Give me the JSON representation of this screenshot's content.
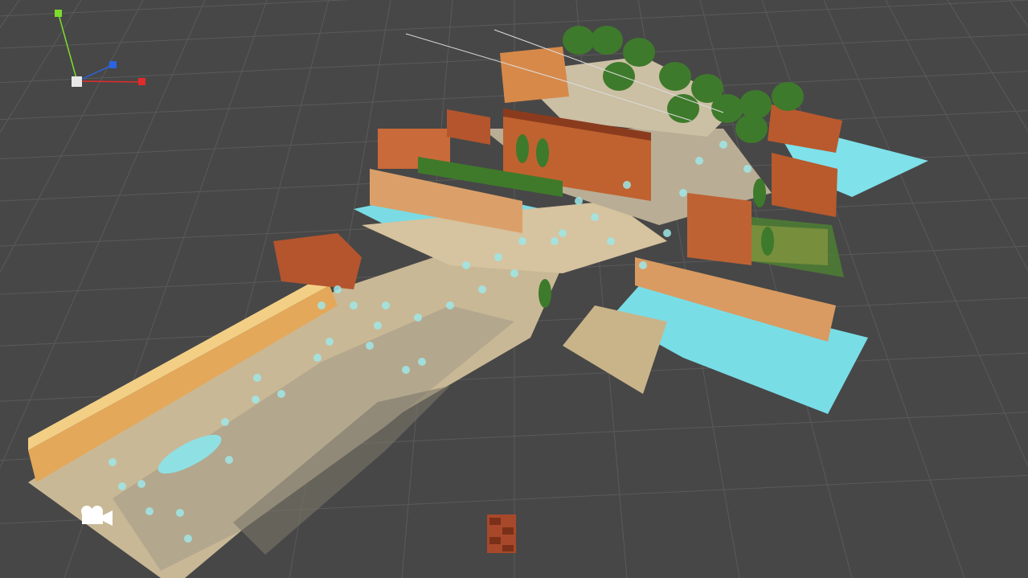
{
  "scene": {
    "view": "scene-view-3d",
    "grid": true,
    "background_color": "#474747",
    "grid_color": "#5a5a5a"
  },
  "gizmo": {
    "axes": [
      {
        "axis": "y",
        "color": "#7ddc2b"
      },
      {
        "axis": "z",
        "color": "#2b63e0"
      },
      {
        "axis": "x",
        "color": "#e02b2b"
      }
    ],
    "center_color": "#e8e8e8"
  },
  "level": {
    "road_color": "#c7b694",
    "water_color": "#79dde6",
    "brick_color": "#b4552e",
    "wall_color": "#e8b565",
    "tree_color": "#3e7a2b",
    "grass_color": "#4e8a2f",
    "car_color": "#8fe0e3",
    "waypoint_color": "#9fe6e6"
  },
  "icons": {
    "camera": "camera-gizmo-icon",
    "crate": "crate-object"
  }
}
